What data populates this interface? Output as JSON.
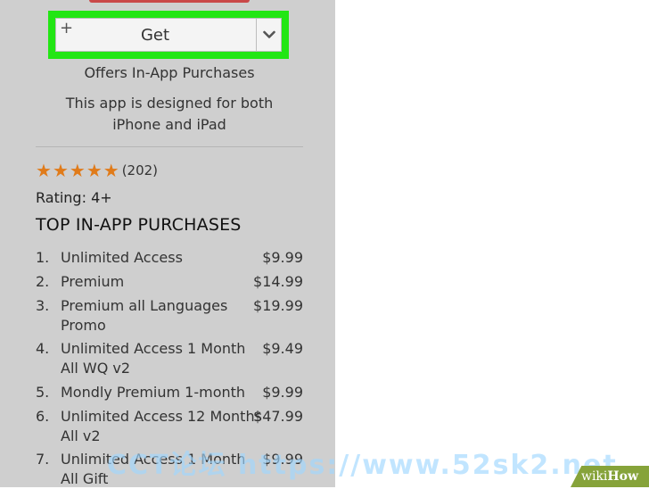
{
  "get_button": {
    "plus": "+",
    "label": "Get"
  },
  "info": {
    "in_app": "Offers In-App Purchases",
    "designed_line1": "This app is designed for both",
    "designed_line2": "iPhone and iPad"
  },
  "rating": {
    "stars": 5,
    "count": "(202)",
    "age_rating": "Rating:  4+"
  },
  "purchases": {
    "title": "TOP IN-APP PURCHASES",
    "items": [
      {
        "num": "1.",
        "name": "Unlimited Access",
        "price": "$9.99"
      },
      {
        "num": "2.",
        "name": "Premium",
        "price": "$14.99"
      },
      {
        "num": "3.",
        "name": "Premium all Languages Promo",
        "price": "$19.99"
      },
      {
        "num": "4.",
        "name": "Unlimited Access 1 Month All WQ v2",
        "price": "$9.49"
      },
      {
        "num": "5.",
        "name": "Mondly Premium 1-month",
        "price": "$9.99"
      },
      {
        "num": "6.",
        "name": "Unlimited Access 12 Months All v2",
        "price": "$47.99"
      },
      {
        "num": "7.",
        "name": "Unlimited Access 1 Month All Gift",
        "price": "$9.99"
      }
    ]
  },
  "watermark": "CCT论坛 https://www.52sk2.net",
  "brand": {
    "wiki": "wiki",
    "how": "How"
  },
  "colors": {
    "highlight": "#22e614",
    "star": "#e07b1a",
    "sidebar": "#cfcfcf"
  }
}
